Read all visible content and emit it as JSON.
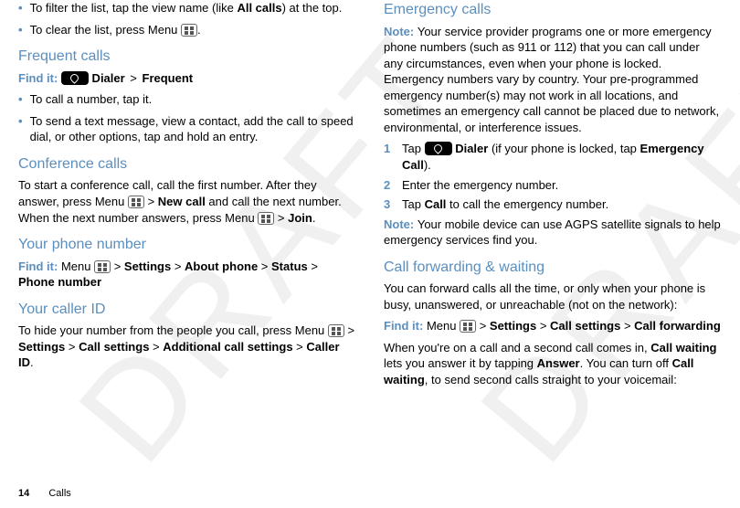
{
  "col1": {
    "bullet1a": "To filter the list, tap the view name (like ",
    "bullet1b": "All calls",
    "bullet1c": ") at the top.",
    "bullet2a": "To clear the list, press Menu ",
    "bullet2b": ".",
    "freq_heading": "Frequent calls",
    "freq_findit": "Find it: ",
    "freq_dialer": " Dialer ",
    "freq_gt": ">",
    "freq_frequent": " Frequent",
    "freq_b1": "To call a number, tap it.",
    "freq_b2": "To send a text message, view a contact, add the call to speed dial, or other options, tap and hold an entry.",
    "conf_heading": "Conference calls",
    "conf_p1": "To start a conference call, call the first number. After they answer, press Menu ",
    "conf_gt1": " > ",
    "conf_newcall": "New call",
    "conf_p2": " and call the next number. When the next number answers, press Menu ",
    "conf_gt2": " > ",
    "conf_join": "Join",
    "conf_dot": ".",
    "num_heading": "Your phone number",
    "num_findit": "Find it: ",
    "num_menu": "Menu ",
    "num_gt": " > ",
    "num_settings": "Settings",
    "num_about": "About phone",
    "num_status": "Status",
    "num_pn": "Phone number",
    "cid_heading": "Your caller ID",
    "cid_p1": "To hide your number from the people you call, press Menu ",
    "cid_gt": " > ",
    "cid_settings": "Settings",
    "cid_cs": "Call settings",
    "cid_acs": "Additional call settings",
    "cid_cid": "Caller ID",
    "cid_dot": "."
  },
  "col2": {
    "em_heading": "Emergency calls",
    "em_note": "Note: ",
    "em_p1": "Your service provider programs one or more emergency phone numbers (such as 911 or 112) that you can call under any circumstances, even when your phone is locked. Emergency numbers vary by country. Your pre-programmed emergency number(s) may not work in all locations, and sometimes an emergency call cannot be placed due to network, environmental, or interference issues.",
    "em_s1a": "Tap ",
    "em_s1b": " Dialer",
    "em_s1c": " (if your phone is locked, tap ",
    "em_s1d": "Emergency Call",
    "em_s1e": ").",
    "em_s2": "Enter the emergency number.",
    "em_s3a": "Tap ",
    "em_s3b": "Call",
    "em_s3c": " to call the emergency number.",
    "em_note2": "Note: ",
    "em_p2": "Your mobile device can use AGPS satellite signals to help emergency services find you.",
    "fw_heading": "Call forwarding & waiting",
    "fw_p1": "You can forward calls all the time, or only when your phone is busy, unanswered, or unreachable (not on the network):",
    "fw_findit": "Find it: ",
    "fw_menu": "Menu ",
    "fw_gt": " > ",
    "fw_settings": "Settings",
    "fw_cs": "Call settings",
    "fw_cf": "Call forwarding",
    "fw_p2a": "When you're on a call and a second call comes in, ",
    "fw_p2b": "Call waiting",
    "fw_p2c": " lets you answer it by tapping ",
    "fw_p2d": "Answer",
    "fw_p2e": ". You can turn off ",
    "fw_p2f": "Call waiting",
    "fw_p2g": ", to send second calls straight to your voicemail:"
  },
  "footer": {
    "page": "14",
    "section": "Calls"
  }
}
